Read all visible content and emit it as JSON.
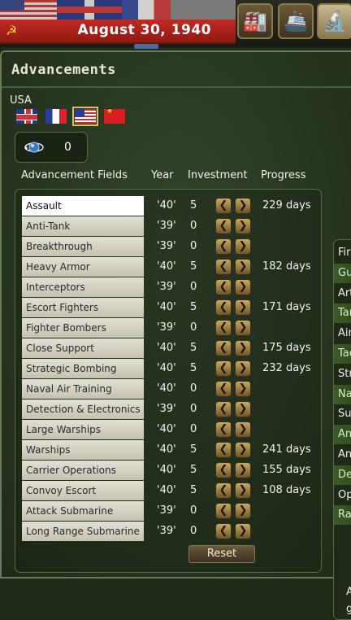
{
  "topbar": {
    "date": "August 30, 1940",
    "buttons": [
      {
        "name": "factory-icon",
        "glyph": "🏭"
      },
      {
        "name": "ship-icon",
        "glyph": "🚢"
      },
      {
        "name": "microscope-icon",
        "glyph": "🔬"
      }
    ]
  },
  "panel": {
    "title": "Advancements",
    "country": "USA",
    "flags": [
      "UK",
      "France",
      "USA",
      "China"
    ],
    "selected_flag": "USA",
    "research_points": "0"
  },
  "columns": {
    "field": "Advancement Fields",
    "year": "Year",
    "investment": "Investment",
    "progress": "Progress"
  },
  "arrows": {
    "left": "❮",
    "right": "❯"
  },
  "fields": [
    {
      "name": "Assault",
      "year": "'40'",
      "investment": "5",
      "progress": "229 days",
      "selected": true
    },
    {
      "name": "Anti-Tank",
      "year": "'39'",
      "investment": "0",
      "progress": ""
    },
    {
      "name": "Breakthrough",
      "year": "'39'",
      "investment": "0",
      "progress": ""
    },
    {
      "name": "Heavy Armor",
      "year": "'40'",
      "investment": "5",
      "progress": "182 days"
    },
    {
      "name": "Interceptors",
      "year": "'39'",
      "investment": "0",
      "progress": ""
    },
    {
      "name": "Escort Fighters",
      "year": "'40'",
      "investment": "5",
      "progress": "171 days"
    },
    {
      "name": "Fighter Bombers",
      "year": "'39'",
      "investment": "0",
      "progress": ""
    },
    {
      "name": "Close Support",
      "year": "'40'",
      "investment": "5",
      "progress": "175 days"
    },
    {
      "name": "Strategic Bombing",
      "year": "'40'",
      "investment": "5",
      "progress": "232 days"
    },
    {
      "name": "Naval Air Training",
      "year": "'40'",
      "investment": "0",
      "progress": ""
    },
    {
      "name": "Detection & Electronics",
      "year": "'39'",
      "investment": "0",
      "progress": ""
    },
    {
      "name": "Large Warships",
      "year": "'40'",
      "investment": "0",
      "progress": ""
    },
    {
      "name": "Warships",
      "year": "'40'",
      "investment": "5",
      "progress": "241 days"
    },
    {
      "name": "Carrier Operations",
      "year": "'40'",
      "investment": "5",
      "progress": "155 days"
    },
    {
      "name": "Convoy Escort",
      "year": "'40'",
      "investment": "5",
      "progress": "108 days"
    },
    {
      "name": "Attack Submarine",
      "year": "'39'",
      "investment": "0",
      "progress": ""
    },
    {
      "name": "Long Range Submarine",
      "year": "'39'",
      "investment": "0",
      "progress": ""
    }
  ],
  "reset_label": "Reset",
  "right_list": [
    {
      "text": "Fir",
      "highlight": false
    },
    {
      "text": "Gu",
      "highlight": true
    },
    {
      "text": "Art",
      "highlight": false
    },
    {
      "text": "Tar",
      "highlight": true
    },
    {
      "text": "Air",
      "highlight": false
    },
    {
      "text": "Tac",
      "highlight": true
    },
    {
      "text": "Str",
      "highlight": false
    },
    {
      "text": "Na",
      "highlight": true
    },
    {
      "text": "Su",
      "highlight": false
    },
    {
      "text": "An",
      "highlight": true
    },
    {
      "text": "An",
      "highlight": false
    },
    {
      "text": "De",
      "highlight": true
    },
    {
      "text": "Op",
      "highlight": false
    },
    {
      "text": "Ra",
      "highlight": true
    }
  ],
  "right_footer": [
    "A",
    "g"
  ]
}
